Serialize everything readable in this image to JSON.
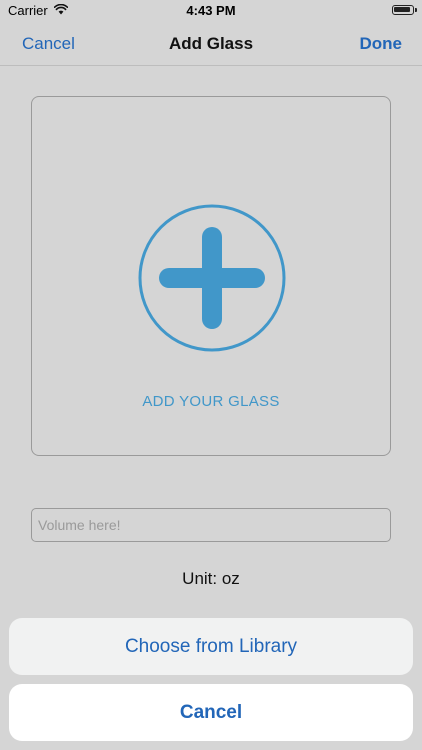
{
  "status_bar": {
    "carrier": "Carrier",
    "time": "4:43 PM",
    "wifi_icon": "wifi-icon",
    "battery_icon": "battery-icon"
  },
  "nav": {
    "left_label": "Cancel",
    "title": "Add Glass",
    "right_label": "Done",
    "accent_color": "#2266b8"
  },
  "glass_card": {
    "icon": "plus-circle-icon",
    "label": "ADD YOUR GLASS",
    "icon_color": "#4197c9"
  },
  "volume": {
    "value": "",
    "placeholder": "Volume here!"
  },
  "unit": {
    "label": "Unit: oz"
  },
  "action_sheet": {
    "option_label": "Choose from Library",
    "cancel_label": "Cancel"
  }
}
